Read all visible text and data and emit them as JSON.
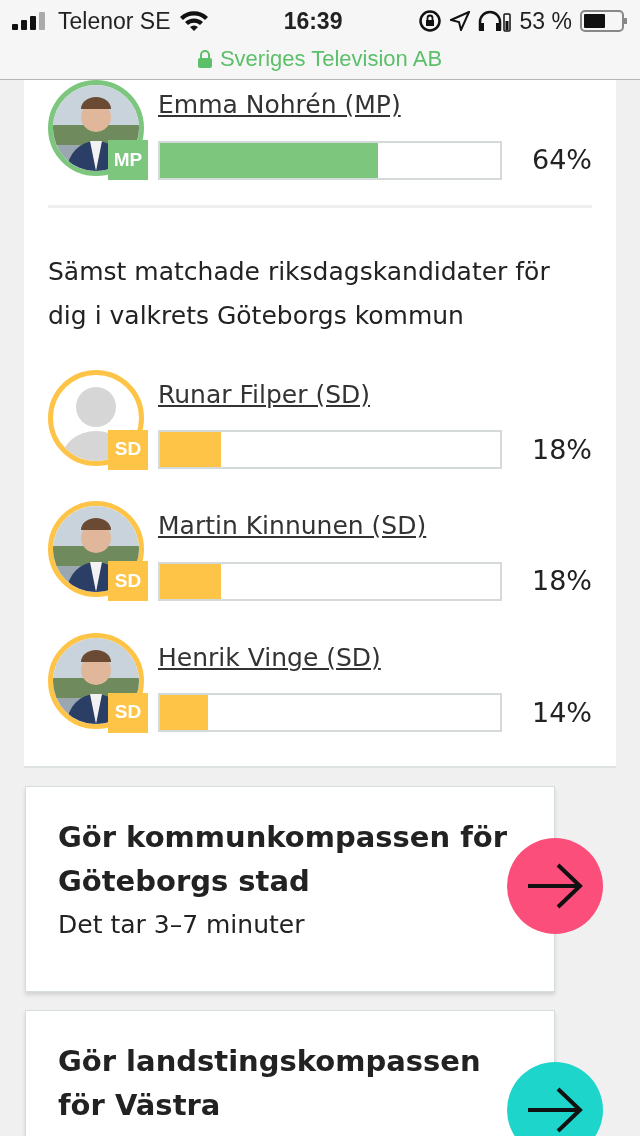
{
  "status_bar": {
    "carrier": "Telenor SE",
    "time": "16:39",
    "battery": "53 %",
    "site": "Sveriges Television AB"
  },
  "best_candidates": [
    {
      "name": "Emma Nohrén (MP)",
      "party": "MP",
      "color": "#7dc67e",
      "level": 0.64,
      "percent": "64%"
    }
  ],
  "worst_heading": "Sämst matchade riksdagskandidater för dig i valkrets Göteborgs kommun",
  "worst_candidates": [
    {
      "name": "Runar Filper (SD)",
      "party": "SD",
      "kind": "placeholder",
      "color": "#fdc448",
      "level": 0.18,
      "percent": "18%"
    },
    {
      "name": "Martin Kinnunen (SD)",
      "party": "SD",
      "color": "#fdc448",
      "level": 0.18,
      "percent": "18%"
    },
    {
      "name": "Henrik Vinge (SD)",
      "party": "SD",
      "color": "#fdc448",
      "level": 0.14,
      "percent": "14%"
    }
  ],
  "cards": [
    {
      "title": "Gör kommunkompassen för Göteborgs stad",
      "subtitle": "Det tar 3–7 minuter",
      "color": "#fb4e7a"
    },
    {
      "title": "Gör landstingskompassen för Västra",
      "color": "#1ed5cc"
    }
  ]
}
